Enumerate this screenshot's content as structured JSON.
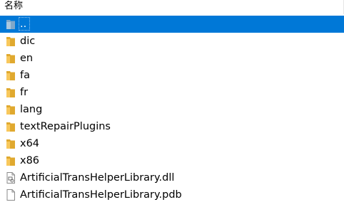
{
  "header": {
    "name_column": "名称"
  },
  "colors": {
    "selection": "#0078d7",
    "folder": "#f8c85c",
    "folder_dark": "#e0a92f"
  },
  "files": [
    {
      "name": "..",
      "type": "parent",
      "icon": "parent-folder-icon",
      "selected": true
    },
    {
      "name": "dic",
      "type": "folder",
      "icon": "folder-icon",
      "selected": false
    },
    {
      "name": "en",
      "type": "folder",
      "icon": "folder-icon",
      "selected": false
    },
    {
      "name": "fa",
      "type": "folder",
      "icon": "folder-icon",
      "selected": false
    },
    {
      "name": "fr",
      "type": "folder",
      "icon": "folder-icon",
      "selected": false
    },
    {
      "name": "lang",
      "type": "folder",
      "icon": "folder-icon",
      "selected": false
    },
    {
      "name": "textRepairPlugins",
      "type": "folder",
      "icon": "folder-icon",
      "selected": false
    },
    {
      "name": "x64",
      "type": "folder",
      "icon": "folder-icon",
      "selected": false
    },
    {
      "name": "x86",
      "type": "folder",
      "icon": "folder-icon",
      "selected": false
    },
    {
      "name": "ArtificialTransHelperLibrary.dll",
      "type": "dll",
      "icon": "dll-file-icon",
      "selected": false
    },
    {
      "name": "ArtificialTransHelperLibrary.pdb",
      "type": "file",
      "icon": "file-icon",
      "selected": false
    }
  ]
}
